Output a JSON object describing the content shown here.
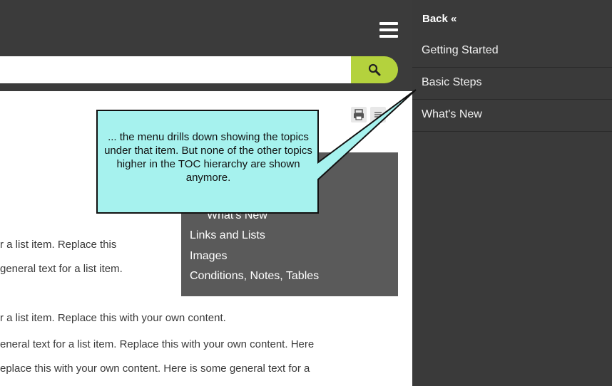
{
  "search": {
    "value": "",
    "placeholder": ""
  },
  "toolbar": {
    "search_icon": "search-icon",
    "print_icon": "printer-icon",
    "expand_icon": "expand-icon"
  },
  "minitoc": {
    "items": [
      "What's New",
      "Links and Lists",
      "Images",
      "Conditions, Notes, Tables"
    ]
  },
  "content": {
    "lines": [
      "r a list item. Replace this",
      "general text for a list item.",
      "r a list item. Replace this with your own content.",
      "eneral text for a list item. Replace this with your own content. Here",
      "eplace this with your own content. Here is some general text for a"
    ]
  },
  "sidebar": {
    "back_label": "Back «",
    "items": [
      {
        "label": "Getting Started"
      },
      {
        "label": "Basic Steps"
      },
      {
        "label": "What's New"
      }
    ]
  },
  "callout": {
    "text": "... the menu drills down showing the topics under that item. But none of the other topics higher in the TOC hierarchy are shown anymore."
  },
  "colors": {
    "topbar": "#3b3b3b",
    "search_button": "#b4d23d",
    "sidebar": "#3a3a3a",
    "minitoc": "#5a5a5a",
    "callout_fill": "#a6f2ee"
  }
}
